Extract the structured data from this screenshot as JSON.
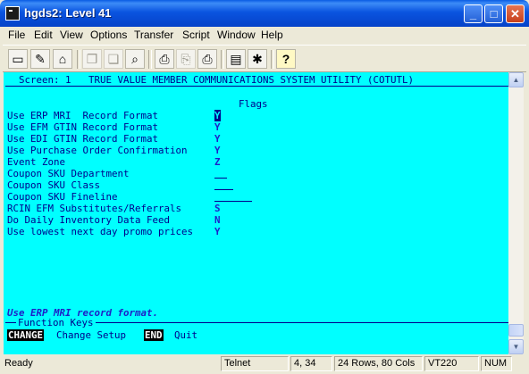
{
  "window": {
    "title": "hgds2: Level 41",
    "controls": {
      "minimize_glyph": "_",
      "maximize_glyph": "□",
      "close_glyph": "✕"
    }
  },
  "menubar": {
    "items": [
      {
        "label": "File"
      },
      {
        "label": "Edit"
      },
      {
        "label": "View"
      },
      {
        "label": "Options"
      },
      {
        "label": "Transfer"
      },
      {
        "label": "Script"
      },
      {
        "label": "Window"
      },
      {
        "label": "Help"
      }
    ]
  },
  "toolbar": {
    "buttons": [
      {
        "icon": "new-session-icon",
        "glyph": "▭",
        "enabled": true
      },
      {
        "icon": "connect-icon",
        "glyph": "✎",
        "enabled": true
      },
      {
        "icon": "disconnect-icon",
        "glyph": "⌂",
        "enabled": true
      },
      {
        "icon": "copy-icon",
        "glyph": "❐",
        "enabled": false
      },
      {
        "icon": "paste-icon",
        "glyph": "❏",
        "enabled": false
      },
      {
        "icon": "find-icon",
        "glyph": "⌕",
        "enabled": true
      },
      {
        "icon": "print-screen-icon",
        "glyph": "⎙",
        "enabled": true
      },
      {
        "icon": "print-selection-icon",
        "glyph": "⎘",
        "enabled": false
      },
      {
        "icon": "printer-icon",
        "glyph": "⎙",
        "enabled": true
      },
      {
        "icon": "session-properties-icon",
        "glyph": "▤",
        "enabled": true
      },
      {
        "icon": "keyboard-map-icon",
        "glyph": "✱",
        "enabled": true
      },
      {
        "icon": "help-icon",
        "glyph": "?",
        "enabled": true
      }
    ]
  },
  "terminal": {
    "header": "Screen: 1   TRUE VALUE MEMBER COMMUNICATIONS SYSTEM UTILITY (COTUTL)",
    "section_title": "Flags",
    "fields": [
      {
        "label": "Use ERP MRI  Record Format",
        "value": "Y",
        "selected": true
      },
      {
        "label": "Use EFM GTIN Record Format",
        "value": "Y"
      },
      {
        "label": "Use EDI GTIN Record Format",
        "value": "Y"
      },
      {
        "label": "Use Purchase Order Confirmation",
        "value": "Y"
      },
      {
        "label": "Event Zone",
        "value": "Z"
      },
      {
        "label": "Coupon SKU Department",
        "value": ""
      },
      {
        "label": "Coupon SKU Class",
        "value": ""
      },
      {
        "label": "Coupon SKU Fineline",
        "value": ""
      },
      {
        "label": "RCIN EFM Substitutes/Referrals",
        "value": "S"
      },
      {
        "label": "Do Daily Inventory Data Feed",
        "value": "N"
      },
      {
        "label": "Use lowest next day promo prices",
        "value": "Y"
      }
    ],
    "message": "Use ERP MRI record format.",
    "function_keys_title": "Function Keys",
    "function_keys": [
      {
        "key": "CHANGE",
        "label": "Change Setup"
      },
      {
        "key": "END",
        "label": "Quit"
      }
    ]
  },
  "statusbar": {
    "status": "Ready",
    "protocol": "Telnet",
    "cursor": "4, 34",
    "size": "24 Rows, 80 Cols",
    "emulation": "VT220",
    "num": "NUM"
  }
}
